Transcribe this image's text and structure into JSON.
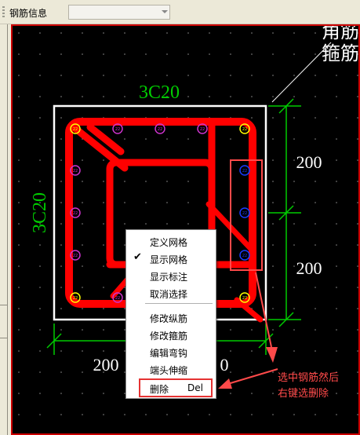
{
  "toolbar": {
    "label": "钢筋信息",
    "combo_value": ""
  },
  "drawing": {
    "top_rebar_label": "3C20",
    "left_rebar_label": "3C20",
    "corner_label_line1": "角筋",
    "corner_label_line2": "箍筋",
    "dim_right_top": "200",
    "dim_right_bottom": "200",
    "dim_bottom_left": "200",
    "dim_bottom_right": "0",
    "bar_dia": "22",
    "colors": {
      "outline": "#ffffff",
      "stirrup": "#ff0000",
      "dimension": "#00cc00",
      "corner_bar": "#ffff00",
      "side_bar": "#cc33cc",
      "selected_bar": "#1a3cff",
      "highlight": "#ff4a4a"
    }
  },
  "context_menu": {
    "items": [
      {
        "label": "定义网格",
        "checked": false
      },
      {
        "label": "显示网格",
        "checked": true
      },
      {
        "label": "显示标注",
        "checked": false
      },
      {
        "label": "取消选择",
        "checked": false
      },
      {
        "label": "修改纵筋",
        "checked": false
      },
      {
        "label": "修改箍筋",
        "checked": false
      },
      {
        "label": "编辑弯钩",
        "checked": false
      },
      {
        "label": "端头伸缩",
        "checked": false
      },
      {
        "label": "删除",
        "shortcut": "Del",
        "checked": false
      }
    ],
    "check_mark": "✔"
  },
  "annotation": {
    "line1": "选中钢筋然后",
    "line2": "右键选删除"
  }
}
